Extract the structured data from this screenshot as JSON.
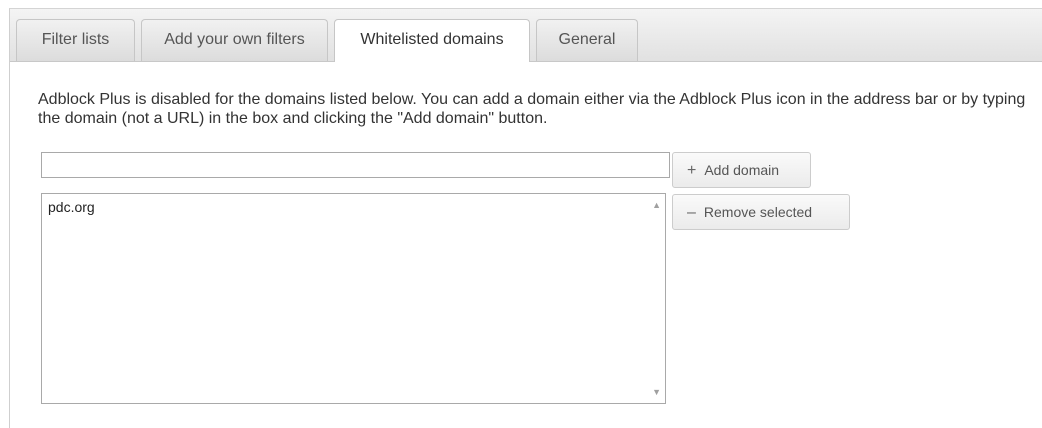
{
  "tabs": [
    {
      "label": "Filter lists",
      "active": false
    },
    {
      "label": "Add your own filters",
      "active": false
    },
    {
      "label": "Whitelisted domains",
      "active": true
    },
    {
      "label": "General",
      "active": false
    }
  ],
  "description": "Adblock Plus is disabled for the domains listed below. You can add a domain either via the Adblock Plus icon in the address bar or by typing the domain (not a URL) in the box and clicking the \"Add domain\" button.",
  "domain_input": {
    "value": "",
    "placeholder": ""
  },
  "buttons": {
    "add_glyph": "+",
    "add_label": "Add domain",
    "remove_glyph": "–",
    "remove_label": "Remove selected"
  },
  "whitelist": {
    "items": [
      "pdc.org"
    ],
    "scroll_up": "▲",
    "scroll_down": "▼"
  },
  "colors": {
    "active_tab_bg": "#ffffff",
    "tab_bg": "#e4e4e4",
    "text": "#333333"
  },
  "icons": {
    "add": "plus-icon",
    "remove": "minus-icon"
  }
}
